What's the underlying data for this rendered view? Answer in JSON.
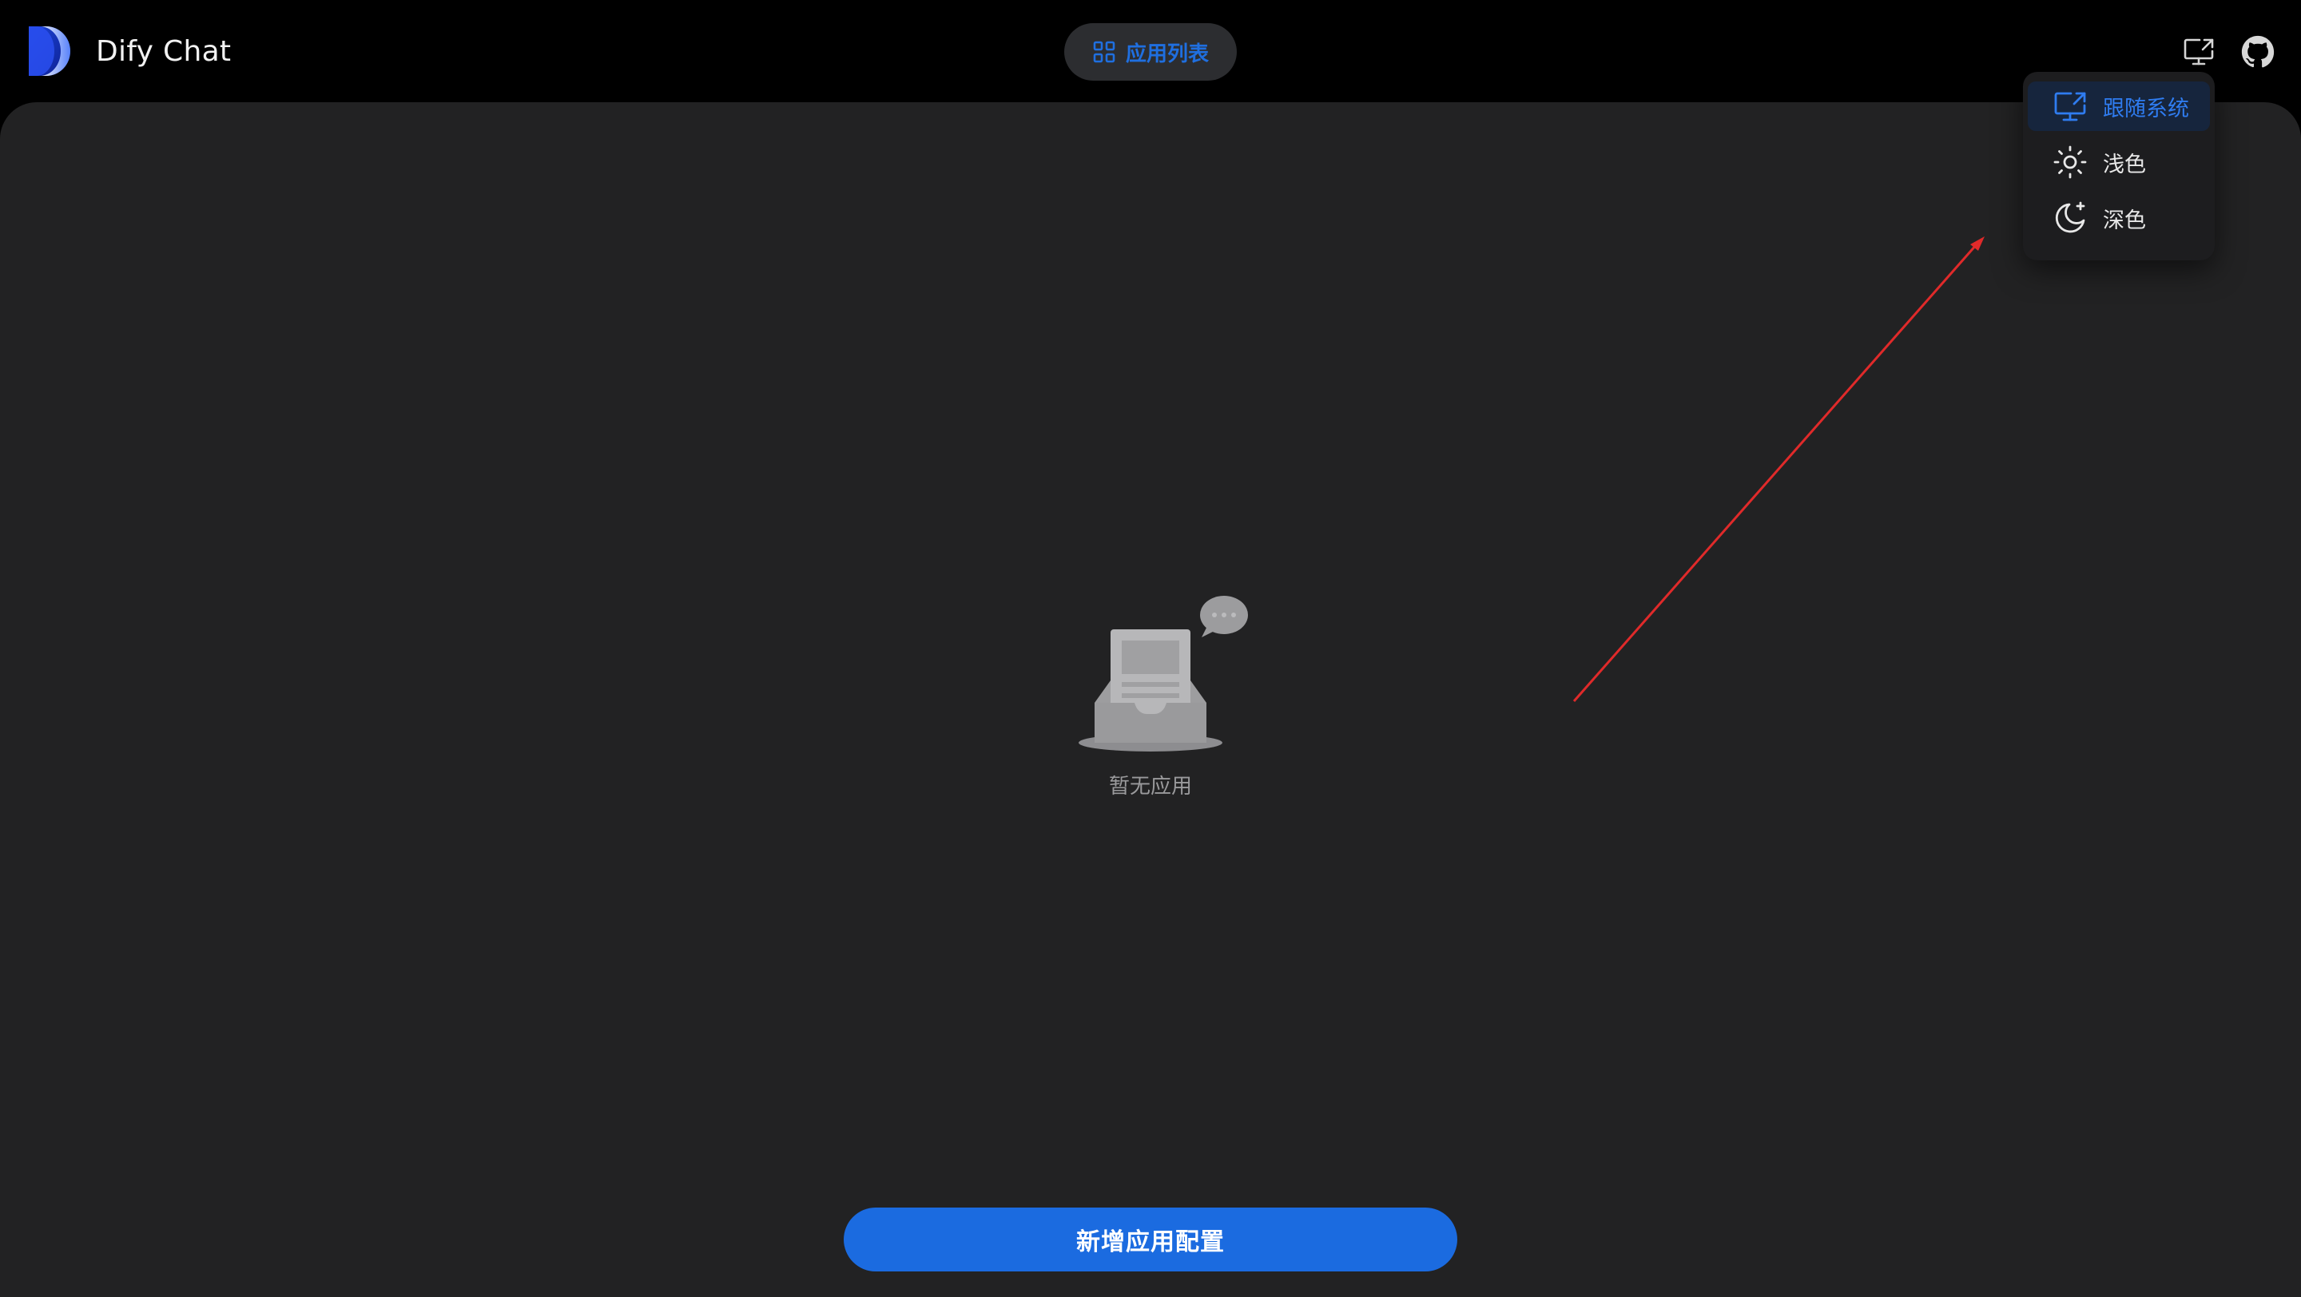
{
  "header": {
    "app_title": "Dify Chat",
    "nav_label": "应用列表",
    "nav_icon": "grid-icon",
    "theme_icon": "monitor-icon",
    "github_icon": "github-icon"
  },
  "theme_menu": {
    "items": [
      {
        "label": "跟随系统",
        "icon": "monitor-icon",
        "active": true
      },
      {
        "label": "浅色",
        "icon": "sun-icon",
        "active": false
      },
      {
        "label": "深色",
        "icon": "moon-icon",
        "active": false
      }
    ]
  },
  "main": {
    "empty_text": "暂无应用",
    "add_button_label": "新增应用配置"
  },
  "colors": {
    "accent": "#1b6be0",
    "page_background": "#000000",
    "panel_background": "#222223",
    "annotation_arrow": "#e02a2a"
  }
}
